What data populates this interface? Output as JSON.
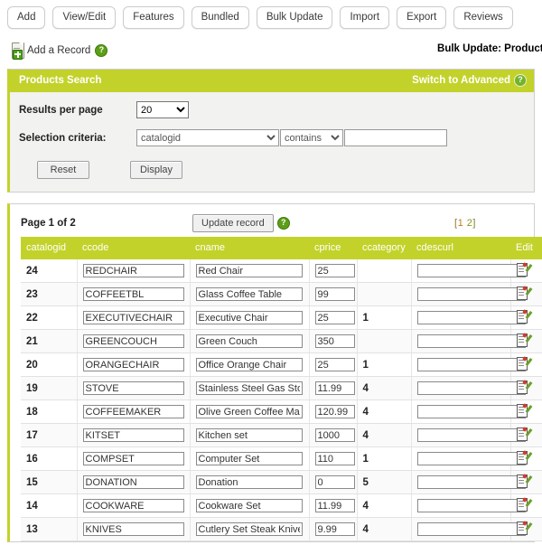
{
  "tabs": [
    {
      "label": "Add"
    },
    {
      "label": "View/Edit"
    },
    {
      "label": "Features"
    },
    {
      "label": "Bundled"
    },
    {
      "label": "Bulk Update"
    },
    {
      "label": "Import"
    },
    {
      "label": "Export"
    },
    {
      "label": "Reviews"
    }
  ],
  "subheader": {
    "add_record_label": "Add a Record",
    "help_glyph": "?",
    "page_title": "Bulk Update: Products"
  },
  "search_panel": {
    "title": "Products Search",
    "switch_label": "Switch to Advanced",
    "help_glyph": "?",
    "results_per_page_label": "Results per page",
    "results_per_page_value": "20",
    "results_per_page_options": [
      "20"
    ],
    "selection_criteria_label": "Selection criteria:",
    "criteria_field_value": "catalogid",
    "criteria_field_options": [
      "catalogid"
    ],
    "criteria_operator_value": "contains",
    "criteria_operator_options": [
      "contains"
    ],
    "criteria_text_value": "",
    "criteria_text_placeholder": "",
    "reset_label": "Reset",
    "display_label": "Display"
  },
  "results": {
    "page_of": "Page 1 of 2",
    "update_label": "Update record",
    "help_glyph": "?",
    "pager_open": "[",
    "pager_current": "1",
    "pager_sep": " ",
    "pager_link": "2",
    "pager_close": "]",
    "columns": [
      "catalogid",
      "ccode",
      "cname",
      "cprice",
      "ccategory",
      "cdescurl",
      "Edit"
    ],
    "rows": [
      {
        "catalogid": "24",
        "ccode": "REDCHAIR",
        "cname": "Red Chair",
        "cprice": "25",
        "ccategory": "",
        "cdescurl": ""
      },
      {
        "catalogid": "23",
        "ccode": "COFFEETBL",
        "cname": "Glass Coffee Table",
        "cprice": "99",
        "ccategory": "",
        "cdescurl": ""
      },
      {
        "catalogid": "22",
        "ccode": "EXECUTIVECHAIR",
        "cname": "Executive Chair",
        "cprice": "25",
        "ccategory": "1",
        "cdescurl": ""
      },
      {
        "catalogid": "21",
        "ccode": "GREENCOUCH",
        "cname": "Green Couch",
        "cprice": "350",
        "ccategory": "",
        "cdescurl": ""
      },
      {
        "catalogid": "20",
        "ccode": "ORANGECHAIR",
        "cname": "Office Orange Chair",
        "cprice": "25",
        "ccategory": "1",
        "cdescurl": ""
      },
      {
        "catalogid": "19",
        "ccode": "STOVE",
        "cname": "Stainless Steel Gas Stove",
        "cprice": "11.99",
        "ccategory": "4",
        "cdescurl": ""
      },
      {
        "catalogid": "18",
        "ccode": "COFFEEMAKER",
        "cname": "Olive Green Coffee Maker",
        "cprice": "120.99",
        "ccategory": "4",
        "cdescurl": ""
      },
      {
        "catalogid": "17",
        "ccode": "KITSET",
        "cname": "Kitchen set",
        "cprice": "1000",
        "ccategory": "4",
        "cdescurl": ""
      },
      {
        "catalogid": "16",
        "ccode": "COMPSET",
        "cname": "Computer Set",
        "cprice": "110",
        "ccategory": "1",
        "cdescurl": ""
      },
      {
        "catalogid": "15",
        "ccode": "DONATION",
        "cname": "Donation",
        "cprice": "0",
        "ccategory": "5",
        "cdescurl": ""
      },
      {
        "catalogid": "14",
        "ccode": "COOKWARE",
        "cname": "Cookware Set",
        "cprice": "11.99",
        "ccategory": "4",
        "cdescurl": ""
      },
      {
        "catalogid": "13",
        "ccode": "KNIVES",
        "cname": "Cutlery Set Steak Knives",
        "cprice": "9.99",
        "ccategory": "4",
        "cdescurl": ""
      }
    ]
  },
  "colors": {
    "accent": "#c3d22a",
    "panel_bg": "#f2f2f0",
    "pager_current": "#c07a12",
    "pager_link": "#7f9a16"
  }
}
